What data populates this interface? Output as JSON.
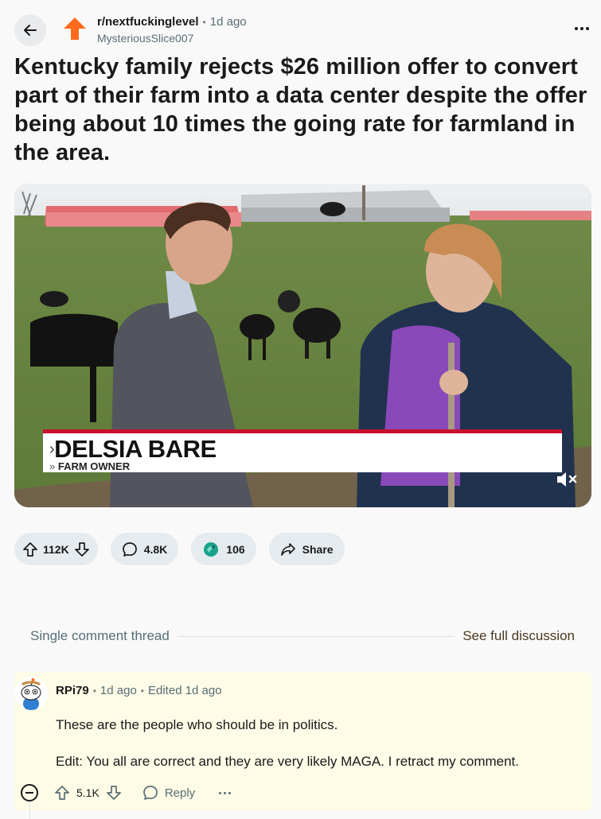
{
  "post": {
    "subreddit": "r/nextfuckinglevel",
    "time": "1d ago",
    "author": "MysteriousSlice007",
    "title": "Kentucky family rejects $26 million offer to convert part of their farm into a data center despite the offer being about 10 times the going rate for farmland in the area."
  },
  "video": {
    "lower_third_name": "DELSIA BARE",
    "lower_third_role": "FARM OWNER"
  },
  "actions": {
    "upvotes": "112K",
    "comments": "4.8K",
    "awards": "106",
    "share": "Share"
  },
  "thread": {
    "label": "Single comment thread",
    "full_link": "See full discussion"
  },
  "comment": {
    "author": "RPi79",
    "time": "1d ago",
    "edited": "Edited 1d ago",
    "body_line1": "These are the people who should be in politics.",
    "body_line2": "Edit: You all are correct and they are very likely MAGA. I retract my comment.",
    "votes": "5.1K",
    "reply": "Reply"
  },
  "colors": {
    "accent": "#ff4500",
    "highlight_bg": "#fefbe6",
    "pill_bg": "#e5ebee",
    "lower_third_red": "#c8102e"
  },
  "icons": [
    "back-arrow-icon",
    "subreddit-icon",
    "more-icon",
    "upvote-icon",
    "downvote-icon",
    "comment-icon",
    "award-icon",
    "share-icon",
    "mute-icon",
    "collapse-icon",
    "avatar-icon"
  ]
}
